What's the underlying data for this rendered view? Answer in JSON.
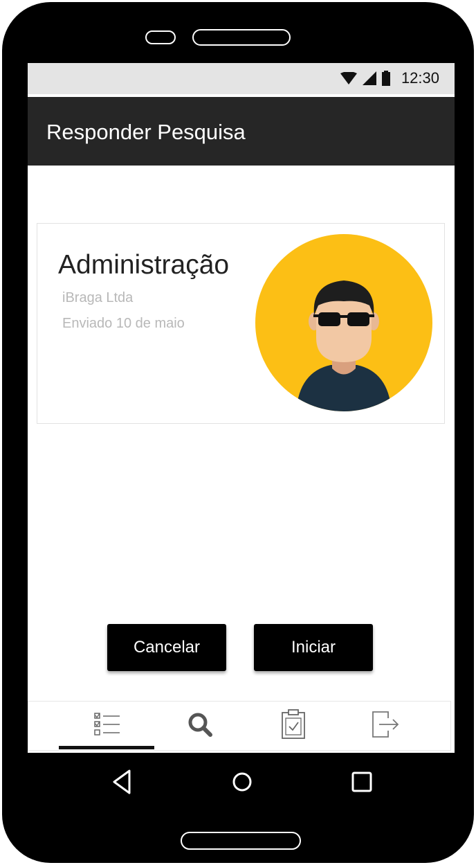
{
  "status_bar": {
    "time": "12:30",
    "icons": [
      "wifi-icon",
      "signal-icon",
      "battery-icon"
    ]
  },
  "app_bar": {
    "title": "Responder Pesquisa"
  },
  "survey_card": {
    "title": "Administração",
    "company": "iBraga Ltda",
    "sent_date": "Enviado 10 de maio",
    "avatar_icon": "person-avatar-icon"
  },
  "actions": {
    "cancel_label": "Cancelar",
    "start_label": "Iniciar"
  },
  "bottom_nav": {
    "items": [
      {
        "icon": "checklist-icon",
        "active": true
      },
      {
        "icon": "search-icon",
        "active": false
      },
      {
        "icon": "clipboard-check-icon",
        "active": false
      },
      {
        "icon": "logout-icon",
        "active": false
      }
    ]
  },
  "system_nav": {
    "items": [
      "back-icon",
      "home-icon",
      "recents-icon"
    ]
  },
  "colors": {
    "app_bar": "#262626",
    "status_bar": "#e4e4e4",
    "avatar_background": "#FCBF15",
    "button": "#000000",
    "muted_text": "#b8b8b8"
  }
}
